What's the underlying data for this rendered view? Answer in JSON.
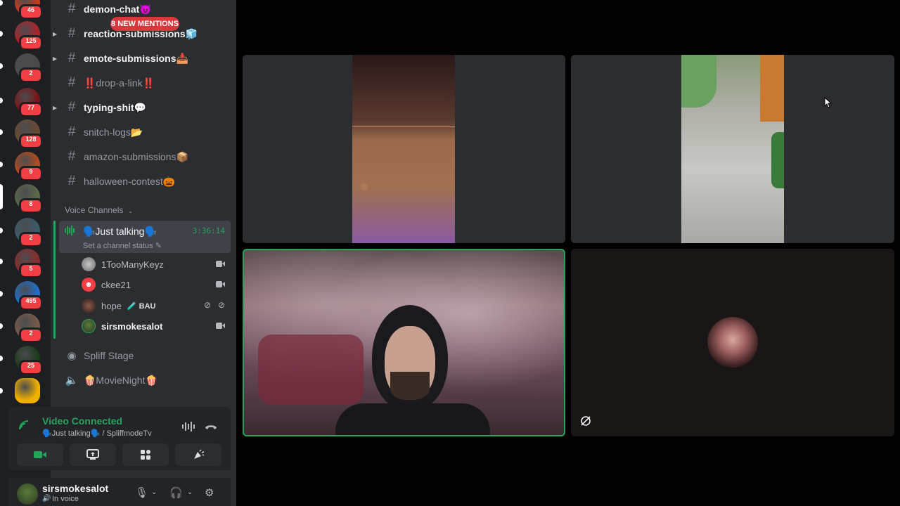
{
  "mentions_pill": "8 NEW MENTIONS",
  "servers": [
    {
      "badge": "46",
      "color": "#c83a1e"
    },
    {
      "badge": "125",
      "color": "#b0222a"
    },
    {
      "badge": "2",
      "color": "#4a4a4a"
    },
    {
      "badge": "77",
      "color": "#7a1414"
    },
    {
      "badge": "128",
      "color": "#6a4a30"
    },
    {
      "badge": "9",
      "color": "#b84a20"
    },
    {
      "badge": "8",
      "color": "#5a6a4a"
    },
    {
      "badge": "2",
      "color": "#3a5a6a"
    },
    {
      "badge": "5",
      "color": "#8a2a2a"
    },
    {
      "badge": "495",
      "color": "#1e6fd0"
    },
    {
      "badge": "2",
      "color": "#7a5a4a"
    },
    {
      "badge": "25",
      "color": "#1a3a1a"
    },
    {
      "badge": "",
      "color": "#f0b000"
    }
  ],
  "channels": [
    {
      "label": "demon-chat😈",
      "unread": true
    },
    {
      "label": "reaction-submissions🧊",
      "unread": true
    },
    {
      "label": "emote-submissions📥",
      "unread": true
    },
    {
      "label": "‼️drop-a-link‼️",
      "unread": false
    },
    {
      "label": "typing-shit💬",
      "unread": true
    },
    {
      "label": "snitch-logs📂",
      "unread": false
    },
    {
      "label": "amazon-submissions📦",
      "unread": false
    },
    {
      "label": "halloween-contest🎃",
      "unread": false
    }
  ],
  "voice_category": "Voice Channels",
  "active_voice": {
    "name": "🗣️Just talking🗣️",
    "timer": "3:36:14",
    "status_placeholder": "Set a channel status"
  },
  "members": [
    {
      "name": "1TooManyKeyz",
      "tag": ""
    },
    {
      "name": "ckee21",
      "tag": ""
    },
    {
      "name": "hope",
      "tag": "🧪 BAU"
    },
    {
      "name": "sirsmokesalot",
      "tag": ""
    }
  ],
  "other_voice": [
    {
      "name": "Spliff Stage",
      "icon": "stage-icon"
    },
    {
      "name": "🍿MovieNight🍿",
      "icon": "speaker-icon"
    }
  ],
  "voice_panel": {
    "status": "Video Connected",
    "location": "🗣️Just talking🗣️ / SpliffmodeTv"
  },
  "user": {
    "name": "sirsmokesalot",
    "status": "In voice"
  },
  "colors": {
    "green": "#23a55a",
    "mention_red": "#da373c",
    "sidebar": "#2b2d31",
    "rail": "#1e1f22"
  }
}
